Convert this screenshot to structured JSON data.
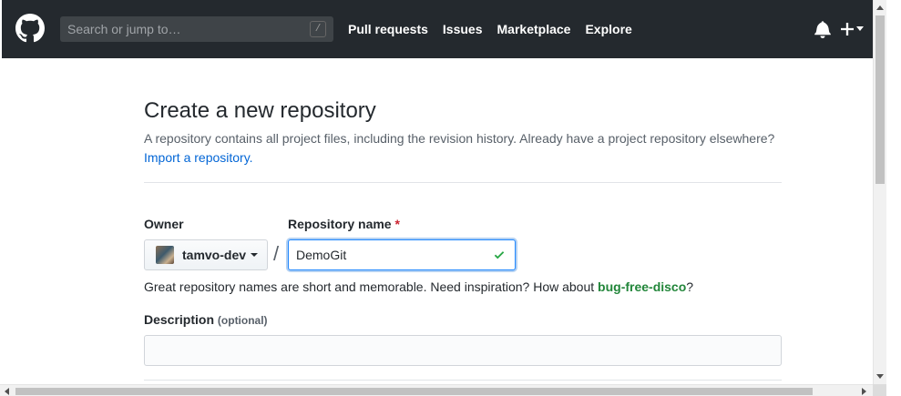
{
  "header": {
    "search": {
      "placeholder": "Search or jump to…",
      "shortcut": "/"
    },
    "nav": [
      {
        "label": "Pull requests"
      },
      {
        "label": "Issues"
      },
      {
        "label": "Marketplace"
      },
      {
        "label": "Explore"
      }
    ],
    "icons": [
      "github-logo-icon",
      "bell-icon",
      "plus-icon",
      "caret-down-icon"
    ]
  },
  "main": {
    "title": "Create a new repository",
    "subhead": "A repository contains all project files, including the revision history. Already have a project repository elsewhere?",
    "import_link": "Import a repository.",
    "owner": {
      "label": "Owner",
      "value": "tamvo-dev"
    },
    "separator": "/",
    "repo_name": {
      "label": "Repository name",
      "required_mark": "*",
      "value": "DemoGit"
    },
    "hint": {
      "prefix": "Great repository names are short and memorable. Need inspiration? How about ",
      "suggestion": "bug-free-disco",
      "suffix": "?"
    },
    "description": {
      "label": "Description",
      "optional": "(optional)",
      "value": ""
    }
  },
  "colors": {
    "header_bg": "#24292e",
    "link": "#0366d6",
    "success": "#28a745",
    "required": "#cb2431",
    "focus_border": "#2188ff"
  }
}
